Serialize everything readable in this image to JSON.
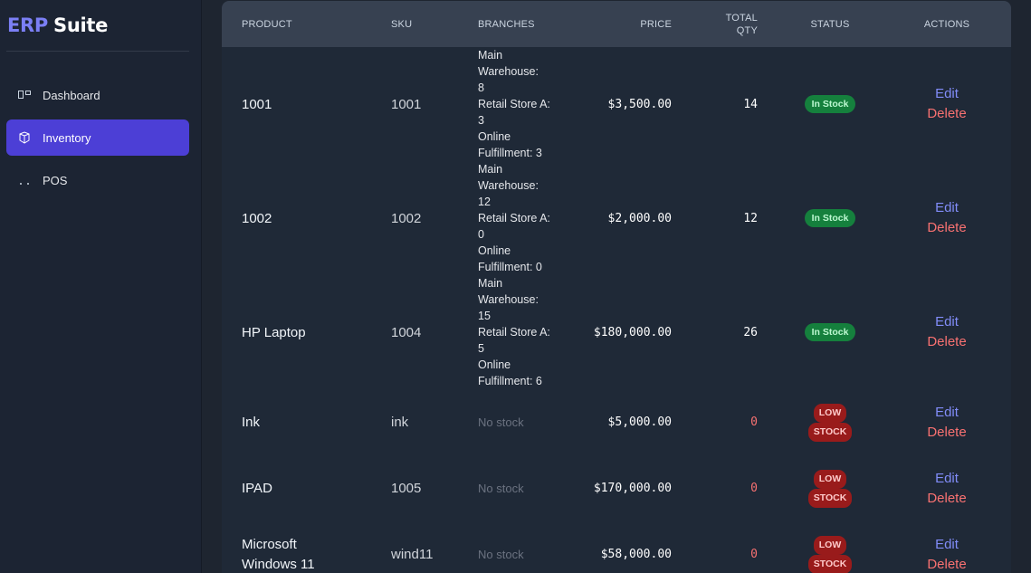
{
  "brand": {
    "part1": "ERP",
    "part2": "Suite"
  },
  "sidebar": {
    "items": [
      {
        "label": "Dashboard",
        "icon": "dashboard-icon",
        "active": false
      },
      {
        "label": "Inventory",
        "icon": "box-icon",
        "active": true
      },
      {
        "label": "POS",
        "icon": "pos-icon",
        "active": false
      }
    ]
  },
  "table": {
    "headers": {
      "product": "PRODUCT",
      "sku": "SKU",
      "branches": "BRANCHES",
      "price": "PRICE",
      "total_qty_1": "TOTAL",
      "total_qty_2": "QTY",
      "status": "STATUS",
      "actions": "ACTIONS"
    },
    "edit_label": "Edit",
    "delete_label": "Delete",
    "rows": [
      {
        "product": "1001",
        "sku": "1001",
        "branches": [
          "Main Warehouse:",
          "8",
          "Retail Store A: 3",
          "Online",
          "Fulfillment: 3"
        ],
        "price": "$3,500.00",
        "qty": "14",
        "status": "In Stock"
      },
      {
        "product": "1002",
        "sku": "1002",
        "branches": [
          "Main Warehouse:",
          "12",
          "Retail Store A: 0",
          "Online",
          "Fulfillment: 0"
        ],
        "price": "$2,000.00",
        "qty": "12",
        "status": "In Stock"
      },
      {
        "product": "HP Laptop",
        "sku": "1004",
        "branches": [
          "Main Warehouse:",
          "15",
          "Retail Store A: 5",
          "Online",
          "Fulfillment: 6"
        ],
        "price": "$180,000.00",
        "qty": "26",
        "status": "In Stock"
      },
      {
        "product": "Ink",
        "sku": "ink",
        "branches_none": "No stock",
        "price": "$5,000.00",
        "qty": "0",
        "status_1": "LOW",
        "status_2": "STOCK"
      },
      {
        "product": "IPAD",
        "sku": "1005",
        "branches_none": "No stock",
        "price": "$170,000.00",
        "qty": "0",
        "status_1": "LOW",
        "status_2": "STOCK"
      },
      {
        "product_1": "Microsoft",
        "product_2": "Windows 11",
        "sku": "wind11",
        "branches_none": "No stock",
        "price": "$58,000.00",
        "qty": "0",
        "status_1": "LOW",
        "status_2": "STOCK"
      }
    ]
  },
  "colors": {
    "accent": "#4c3fd6",
    "in_stock": "#15803d",
    "low_stock": "#991b1b",
    "edit": "#818cf8",
    "delete": "#f87171"
  }
}
